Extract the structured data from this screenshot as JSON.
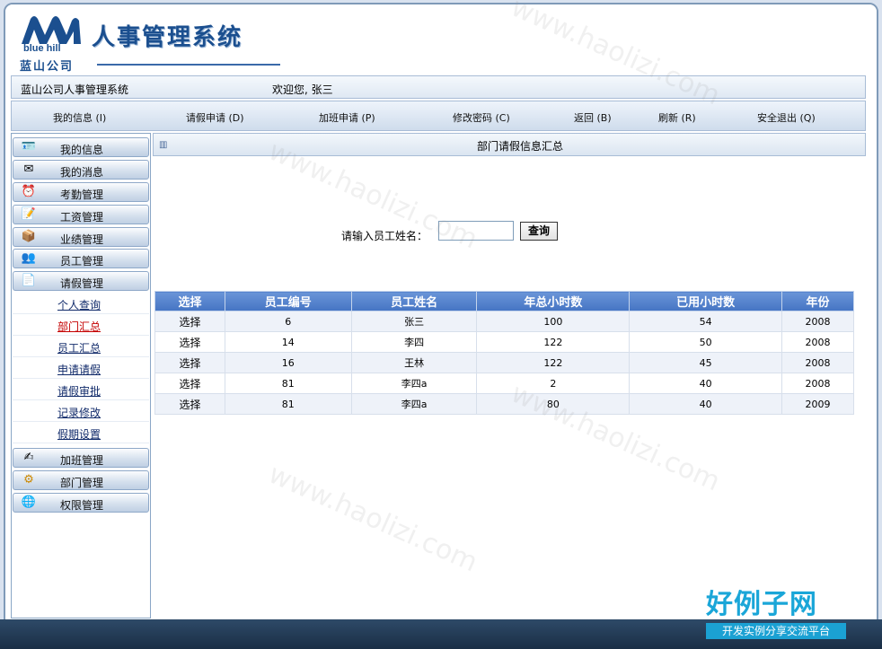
{
  "branding": {
    "logo_en": "blue hill",
    "logo_cn": "蓝山公司",
    "app_title": "人事管理系统"
  },
  "infobar": {
    "system_name": "蓝山公司人事管理系统",
    "welcome": "欢迎您, 张三"
  },
  "nav": {
    "items": [
      "我的信息 (I)",
      "请假申请 (D)",
      "加班申请 (P)",
      "修改密码 (C)",
      "返回 (B)",
      "刷新 (R)",
      "安全退出 (Q)"
    ]
  },
  "sidebar": {
    "menus": [
      {
        "label": "我的信息",
        "icon": "person-card-icon"
      },
      {
        "label": "我的消息",
        "icon": "message-icon"
      },
      {
        "label": "考勤管理",
        "icon": "clock-icon"
      },
      {
        "label": "工资管理",
        "icon": "notepad-icon"
      },
      {
        "label": "业绩管理",
        "icon": "box-icon"
      },
      {
        "label": "员工管理",
        "icon": "people-icon"
      },
      {
        "label": "请假管理",
        "icon": "document-icon"
      }
    ],
    "submenu": [
      {
        "label": "个人查询",
        "active": false
      },
      {
        "label": "部门汇总",
        "active": true
      },
      {
        "label": "员工汇总",
        "active": false
      },
      {
        "label": "申请请假",
        "active": false
      },
      {
        "label": "请假审批",
        "active": false
      },
      {
        "label": "记录修改",
        "active": false
      },
      {
        "label": "假期设置",
        "active": false
      }
    ],
    "menus_after": [
      {
        "label": "加班管理",
        "icon": "pencil-doc-icon"
      },
      {
        "label": "部门管理",
        "icon": "gears-icon"
      },
      {
        "label": "权限管理",
        "icon": "globe-key-icon"
      }
    ]
  },
  "main": {
    "title": "部门请假信息汇总",
    "search_label": "请输入员工姓名：",
    "search_value": "",
    "search_button": "查询"
  },
  "table": {
    "headers": [
      "选择",
      "员工编号",
      "员工姓名",
      "年总小时数",
      "已用小时数",
      "年份"
    ],
    "rows": [
      [
        "选择",
        "6",
        "张三",
        "100",
        "54",
        "2008"
      ],
      [
        "选择",
        "14",
        "李四",
        "122",
        "50",
        "2008"
      ],
      [
        "选择",
        "16",
        "王林",
        "122",
        "45",
        "2008"
      ],
      [
        "选择",
        "81",
        "李四a",
        "2",
        "40",
        "2008"
      ],
      [
        "选择",
        "81",
        "李四a",
        "80",
        "40",
        "2009"
      ]
    ]
  },
  "watermark": {
    "text": "www.haolizi.com",
    "brand_big": "好例子网",
    "brand_small": "开发实例分享交流平台"
  },
  "colors": {
    "accent": "#1b4f8f",
    "table_header": "#4a78c8",
    "active_link": "#c40000",
    "brand": "#1ba1d3"
  }
}
